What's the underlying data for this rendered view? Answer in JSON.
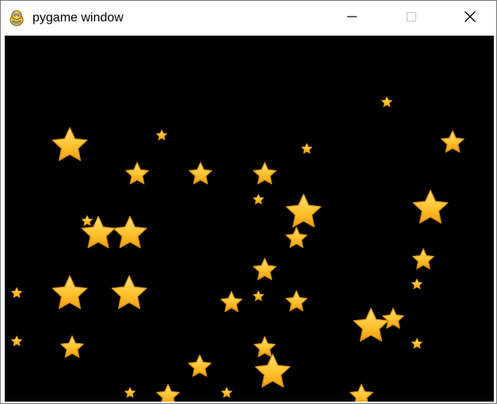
{
  "window": {
    "title": "pygame window",
    "app_icon": "pygame-snake-icon",
    "controls": {
      "minimize_icon": "minimize-icon",
      "maximize_icon": "maximize-icon",
      "close_icon": "close-icon"
    }
  },
  "canvas": {
    "background_color": "#000000",
    "star_icon": "star-icon",
    "star_colors": {
      "fill_light": "#ffd35a",
      "fill_dark": "#f2a516",
      "outline": "#d08a0e"
    }
  }
}
